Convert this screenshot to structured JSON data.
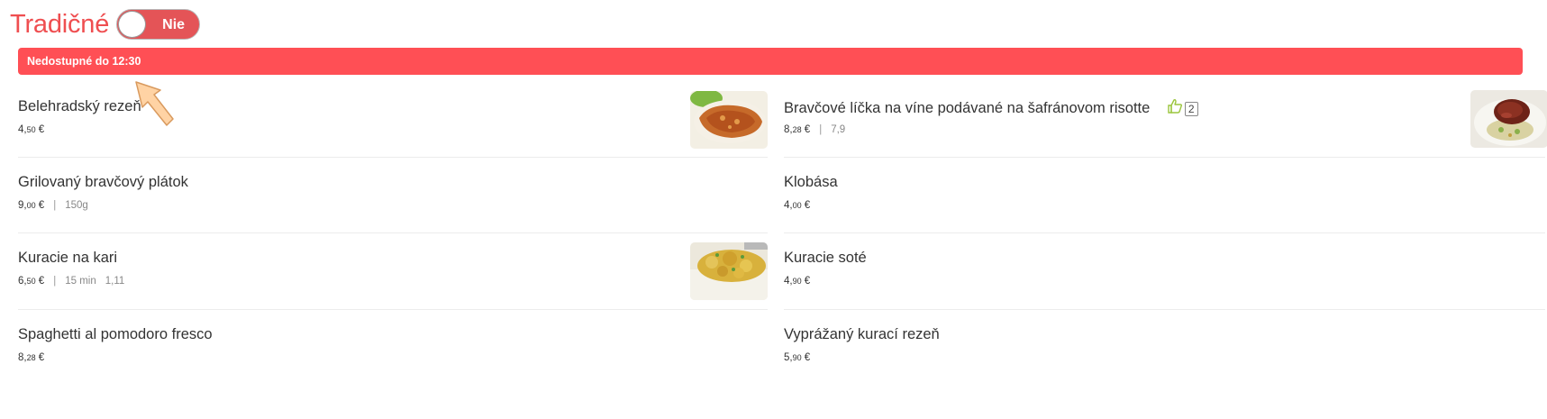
{
  "header": {
    "category_title": "Tradičné",
    "toggle_label": "Nie",
    "toggle_on": false
  },
  "banner": {
    "text": "Nedostupné do 12:30"
  },
  "colors": {
    "accent": "#ef4e50",
    "banner": "#ff4f55",
    "like_icon": "#9bc53d"
  },
  "menu": {
    "left": [
      {
        "name": "Belehradský rezeň",
        "price_main": "4,",
        "price_cents": "50",
        "currency": " €",
        "has_image": true,
        "image": "schnitzel"
      },
      {
        "name": "Grilovaný bravčový plátok",
        "price_main": "9,",
        "price_cents": "00",
        "currency": " €",
        "sep": "|",
        "weight": "150g",
        "has_image": false
      },
      {
        "name": "Kuracie na kari",
        "price_main": "6,",
        "price_cents": "50",
        "currency": " €",
        "sep": "|",
        "time": "15 min",
        "extra": "1,11",
        "has_image": true,
        "image": "curry"
      },
      {
        "name": "Spaghetti al pomodoro fresco",
        "price_main": "8,",
        "price_cents": "28",
        "currency": " €",
        "has_image": false
      }
    ],
    "right": [
      {
        "name": "Bravčové líčka na víne podávané na šafránovom risotte",
        "price_main": "8,",
        "price_cents": "28",
        "currency": " €",
        "sep": "|",
        "rating": "7,9",
        "likes": "2",
        "has_image": true,
        "image": "cheeks"
      },
      {
        "name": "Klobása",
        "price_main": "4,",
        "price_cents": "00",
        "currency": " €",
        "has_image": false
      },
      {
        "name": "Kuracie soté",
        "price_main": "4,",
        "price_cents": "90",
        "currency": " €",
        "has_image": false
      },
      {
        "name": "Vyprážaný kurací rezeň",
        "price_main": "5,",
        "price_cents": "90",
        "currency": " €",
        "has_image": false
      }
    ]
  }
}
